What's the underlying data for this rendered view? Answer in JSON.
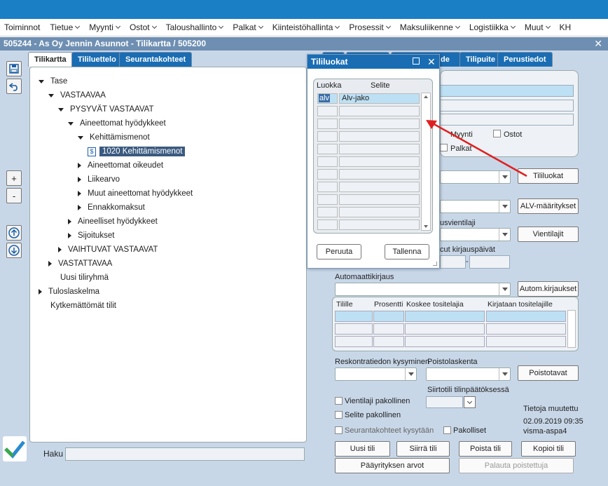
{
  "menu": [
    "Toiminnot",
    "Tietue",
    "Myynti",
    "Ostot",
    "Taloushallinto",
    "Palkat",
    "Kiinteistöhallinta",
    "Prosessit",
    "Maksuliikenne",
    "Logistiikka",
    "Muut",
    "KH"
  ],
  "window_title": "505244 - As Oy Jennin Asunnot - Tilikartta / 505200",
  "left_tabs": [
    "Tilikartta",
    "Tililuettelo",
    "Seurantakohteet"
  ],
  "tree": [
    {
      "label": "Tase",
      "level": 0,
      "state": "open"
    },
    {
      "label": "VASTAAVAA",
      "level": 1,
      "state": "open"
    },
    {
      "label": "PYSYVÄT VASTAAVAT",
      "level": 2,
      "state": "open"
    },
    {
      "label": "Aineettomat hyödykkeet",
      "level": 3,
      "state": "open"
    },
    {
      "label": "Kehittämismenot",
      "level": 4,
      "state": "open"
    },
    {
      "label": "1020 Kehittämismenot",
      "level": 5,
      "state": "leaf",
      "selected": true
    },
    {
      "label": "Aineettomat oikeudet",
      "level": 4,
      "state": "closed"
    },
    {
      "label": "Liikearvo",
      "level": 4,
      "state": "closed"
    },
    {
      "label": "Muut aineettomat hyödykkeet",
      "level": 4,
      "state": "closed"
    },
    {
      "label": "Ennakkomaksut",
      "level": 4,
      "state": "closed"
    },
    {
      "label": "Aineelliset hyödykkeet",
      "level": 3,
      "state": "closed"
    },
    {
      "label": "Sijoitukset",
      "level": 3,
      "state": "closed"
    },
    {
      "label": "VAIHTUVAT VASTAAVAT",
      "level": 2,
      "state": "closed"
    },
    {
      "label": "VASTATTAVAA",
      "level": 1,
      "state": "closed"
    },
    {
      "label": "Uusi tiliryhmä",
      "level": 1,
      "state": "none"
    },
    {
      "label": "Tuloslaskelma",
      "level": 0,
      "state": "closed"
    },
    {
      "label": "Kytkemättömät tilit",
      "level": 0,
      "state": "none"
    }
  ],
  "search_label": "Haku",
  "right_tabs": [
    "de",
    "Tilipuite",
    "Perustiedot"
  ],
  "checks": {
    "myynti": "Myynti",
    "ostot": "Ostot",
    "palkat": "Palkat"
  },
  "buttons": {
    "tililuokat": "Tililuokat",
    "alv": "ALV-määritykset",
    "vientilajit": "Vientilajit",
    "autom": "Autom.kirjaukset",
    "poistotavat": "Poistotavat",
    "uusi": "Uusi tili",
    "siirra": "Siirrä tili",
    "poista": "Poista tili",
    "kopioi": "Kopioi tili",
    "paayritys": "Pääyrityksen arvot",
    "palauta": "Palauta poistettuja"
  },
  "labels": {
    "vientilaji_partial": "usvientilaji",
    "kirjauspaivat_partial": "cut kirjauspäivät",
    "dash": "-",
    "automaattikirjaus": "Automaattikirjaus",
    "reskontra": "Reskontratiedon kysyminen",
    "poistolaskenta": "Poistolaskenta",
    "siirtotili": "Siirtotili tilinpäätöksessä",
    "vientilaji_pakollinen": "Vientilaji pakollinen",
    "selite_pakollinen": "Selite pakollinen",
    "seuranta": "Seurantakohteet kysytään",
    "pakolliset": "Pakolliset",
    "muutettu_title": "Tietoja muutettu",
    "muutettu_date": "02.09.2019 09:35",
    "muutettu_user": "visma-aspa4"
  },
  "auto_grid_headers": [
    "Tilille",
    "Prosentti",
    "Koskee tositelajia",
    "Kirjataan tositelajille"
  ],
  "dialog": {
    "title": "Tililuokat",
    "col_luokka": "Luokka",
    "col_selite": "Selite",
    "rows": [
      {
        "luokka": "alv",
        "selite": "Alv-jako"
      }
    ],
    "cancel": "Peruuta",
    "save": "Tallenna"
  },
  "colors": {
    "accent": "#1a7fc4",
    "tab_blue": "#1a6db3",
    "arrow": "#e02020"
  }
}
